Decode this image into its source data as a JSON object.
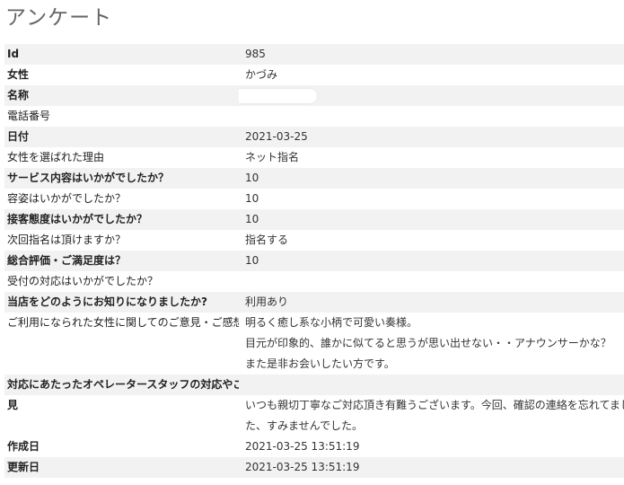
{
  "page": {
    "title": "アンケート"
  },
  "rows": [
    {
      "label": "Id",
      "value": "985"
    },
    {
      "label": "女性",
      "value": "かづみ"
    },
    {
      "label": "名称",
      "value": ""
    },
    {
      "label": "電話番号",
      "value": ""
    },
    {
      "label": "日付",
      "value": "2021-03-25"
    },
    {
      "label": "女性を選ばれた理由",
      "value": "ネット指名"
    },
    {
      "label": "サービス内容はいかがでしたか？",
      "value": "10"
    },
    {
      "label": "容姿はいかがでしたか？",
      "value": "10"
    },
    {
      "label": "接客態度はいかがでしたか？",
      "value": "10"
    },
    {
      "label": "次回指名は頂けますか？",
      "value": "指名する"
    },
    {
      "label": "総合評価・ご満足度は？",
      "value": "10"
    },
    {
      "label": "受付の対応はいかがでしたか？",
      "value": ""
    },
    {
      "label": "当店をどのようにお知りになりましたか?",
      "value": "利用あり"
    },
    {
      "label": "ご利用になられた女性に関してのご意見・ご感想",
      "lines": [
        "明るく癒し系な小柄で可愛い奏様。",
        "目元が印象的、誰かに似てると思うが思い出せない・・アナウンサーかな？",
        "また是非お会いしたい方です。"
      ]
    },
    {
      "label_line1": "対応にあたったオペレータースタッフの対応やご意",
      "label_line2": "見",
      "lines": [
        "",
        "いつも親切丁寧なご対応頂き有難うございます。今回、確認の連絡を忘れてまし",
        "た、すみませんでした。"
      ]
    },
    {
      "label": "作成日",
      "value": "2021-03-25 13:51:19"
    },
    {
      "label": "更新日",
      "value": "2021-03-25 13:51:19"
    }
  ]
}
